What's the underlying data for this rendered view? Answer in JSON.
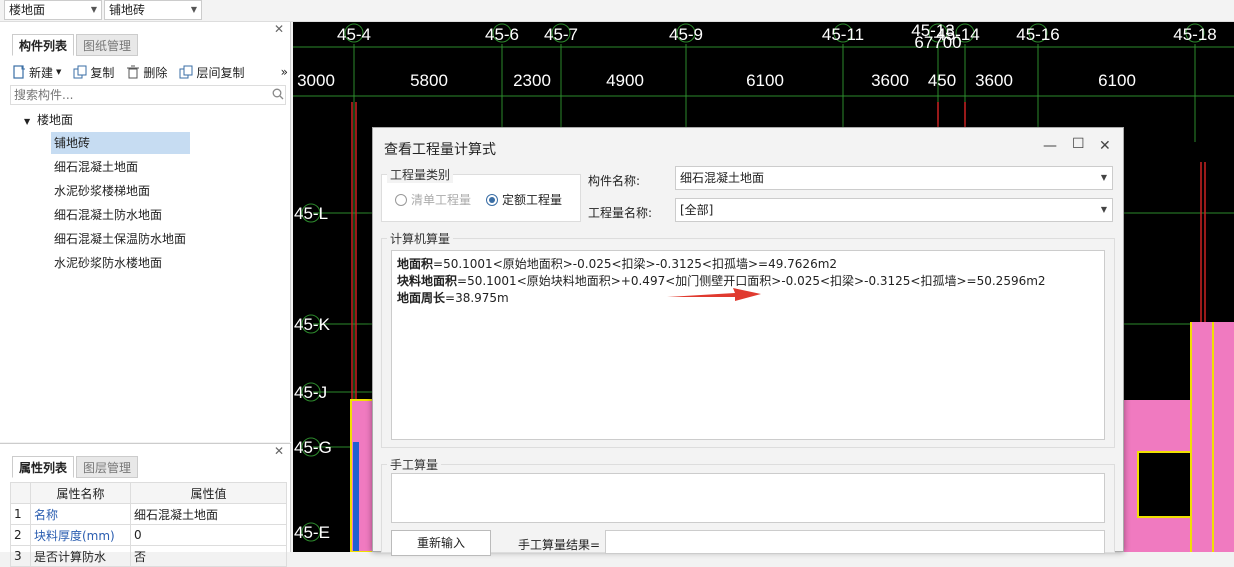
{
  "topbar": {
    "floor_select": "楼地面",
    "type_select": "铺地砖"
  },
  "component_panel": {
    "tabs": [
      "构件列表",
      "图纸管理"
    ],
    "toolbar": {
      "new": "新建",
      "copy": "复制",
      "delete": "删除",
      "floor_copy": "层间复制",
      "more": "»"
    },
    "search_placeholder": "搜索构件...",
    "tree": {
      "root": "楼地面",
      "items": [
        "铺地砖",
        "细石混凝土地面",
        "水泥砂浆楼梯地面",
        "细石混凝土防水地面",
        "细石混凝土保温防水地面",
        "水泥砂浆防水楼地面"
      ]
    }
  },
  "property_panel": {
    "tabs": [
      "属性列表",
      "图层管理"
    ],
    "headers": [
      "属性名称",
      "属性值"
    ],
    "rows": [
      {
        "no": "1",
        "name": "名称",
        "value": "细石混凝土地面"
      },
      {
        "no": "2",
        "name": "块料厚度(mm)",
        "value": "0"
      },
      {
        "no": "3",
        "name": "是否计算防水",
        "value": "否"
      }
    ]
  },
  "canvas": {
    "top_axes": [
      "45-4",
      "45-6",
      "45-7",
      "45-9",
      "45-11",
      "45-13",
      "45-14",
      "45-16",
      "45-18"
    ],
    "dims": [
      "3000",
      "5800",
      "2300",
      "4900",
      "6100",
      "3600",
      "450",
      "3600",
      "6100"
    ],
    "overlap_dim": "67700",
    "left_axes": [
      "45-L",
      "45-K",
      "45-J",
      "45-G",
      "45-E"
    ],
    "colors": {
      "background": "#000000",
      "axis_line": "#2d8a2d",
      "red_line": "#cc2222",
      "pink_fill": "#f07ac0",
      "yellow": "#f0e000"
    }
  },
  "dialog": {
    "title": "查看工程量计算式",
    "quantity_category": {
      "label": "工程量类别",
      "options": [
        {
          "label": "清单工程量",
          "checked": false,
          "disabled": true
        },
        {
          "label": "定额工程量",
          "checked": true,
          "disabled": false
        }
      ]
    },
    "component_name_label": "构件名称:",
    "component_name_value": "细石混凝土地面",
    "quantity_name_label": "工程量名称:",
    "quantity_name_value": "[全部]",
    "computer_calc_label": "计算机算量",
    "lines": [
      {
        "name": "地面积",
        "formula": "=50.1001<原始地面积>-0.025<扣梁>-0.3125<扣孤墙>=49.7626m2"
      },
      {
        "name": "块料地面积",
        "formula": "=50.1001<原始块料地面积>+0.497<加门侧壁开口面积>-0.025<扣梁>-0.3125<扣孤墙>=50.2596m2"
      },
      {
        "name": "地面周长",
        "formula": "=38.975m"
      }
    ],
    "arrow_color": "#e03a2f",
    "manual_calc_label": "手工算量",
    "reenter_button": "重新输入",
    "manual_result_label": "手工算量结果="
  }
}
